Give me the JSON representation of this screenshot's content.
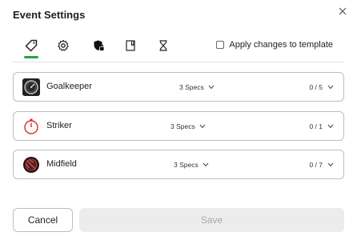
{
  "dialog": {
    "title": "Event Settings"
  },
  "toolbar": {
    "tabs": [
      {
        "icon": "tag-icon",
        "active": true
      },
      {
        "icon": "gear-icon",
        "active": false
      },
      {
        "icon": "shield-lock-icon",
        "active": false
      },
      {
        "icon": "notebook-icon",
        "active": false
      },
      {
        "icon": "hourglass-icon",
        "active": false
      }
    ],
    "apply_checkbox_checked": false,
    "apply_label": "Apply changes to template"
  },
  "positions": [
    {
      "name": "Goalkeeper",
      "specs": "3 Specs",
      "count": "0 / 5",
      "icon": "goalkeeper-clock-icon"
    },
    {
      "name": "Striker",
      "specs": "3 Specs",
      "count": "0 / 1",
      "icon": "striker-timer-icon"
    },
    {
      "name": "Midfield",
      "specs": "3 Specs",
      "count": "0 / 7",
      "icon": "midfield-ball-icon"
    }
  ],
  "footer": {
    "cancel_label": "Cancel",
    "save_label": "Save",
    "save_enabled": false
  },
  "colors": {
    "accent": "#2aa33a",
    "border": "#bdbdbd",
    "disabled_bg": "#ececec",
    "striker_red": "#e02b2b",
    "midfield_dark": "#3a1a1a"
  }
}
